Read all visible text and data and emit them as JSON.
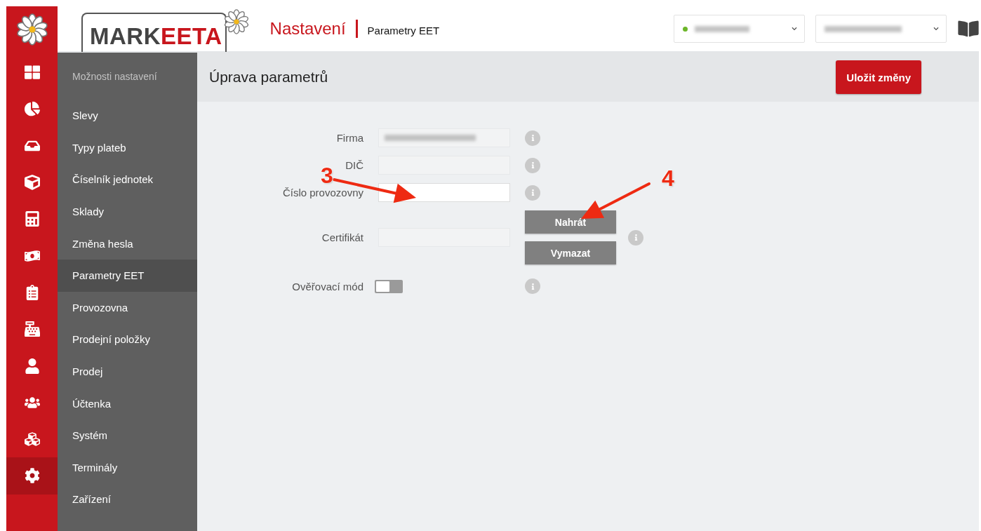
{
  "header": {
    "logo": {
      "dark": "MARK",
      "accent": "EETA"
    },
    "section": "Nastavení",
    "page": "Parametry EET",
    "selects": [
      {
        "kind": "status",
        "color": "#6cb629"
      },
      {
        "kind": "plain"
      }
    ]
  },
  "rail": [
    {
      "selected": false
    },
    {
      "selected": false
    },
    {
      "selected": false
    },
    {
      "selected": false
    },
    {
      "selected": false
    },
    {
      "selected": false
    },
    {
      "selected": false
    },
    {
      "selected": false
    },
    {
      "selected": false
    },
    {
      "selected": false
    },
    {
      "selected": false
    },
    {
      "selected": true
    }
  ],
  "sidebar": {
    "heading": "Možnosti nastavení",
    "items": [
      {
        "label": "Slevy",
        "selected": false
      },
      {
        "label": "Typy plateb",
        "selected": false
      },
      {
        "label": "Číselník jednotek",
        "selected": false
      },
      {
        "label": "Sklady",
        "selected": false
      },
      {
        "label": "Změna hesla",
        "selected": false
      },
      {
        "label": "Parametry EET",
        "selected": true
      },
      {
        "label": "Provozovna",
        "selected": false
      },
      {
        "label": "Prodejní položky",
        "selected": false
      },
      {
        "label": "Prodej",
        "selected": false
      },
      {
        "label": "Účtenka",
        "selected": false
      },
      {
        "label": "Systém",
        "selected": false
      },
      {
        "label": "Terminály",
        "selected": false
      },
      {
        "label": "Zařízení",
        "selected": false
      }
    ]
  },
  "content": {
    "title": "Úprava parametrů",
    "save_button": "Uložit změny",
    "form": [
      {
        "kind": "input",
        "label": "Firma",
        "disabled": true,
        "redacted": true
      },
      {
        "kind": "input",
        "label": "DIČ",
        "disabled": true,
        "redacted": false
      },
      {
        "kind": "input",
        "label": "Číslo provozovny",
        "disabled": false,
        "redacted": false
      },
      {
        "kind": "file",
        "label": "Certifikát",
        "disabled": true,
        "buttons": [
          "Nahrát",
          "Vymazat"
        ]
      },
      {
        "kind": "toggle",
        "label": "Ověřovací mód",
        "on": false
      }
    ]
  },
  "annotations": [
    "3",
    "4"
  ]
}
